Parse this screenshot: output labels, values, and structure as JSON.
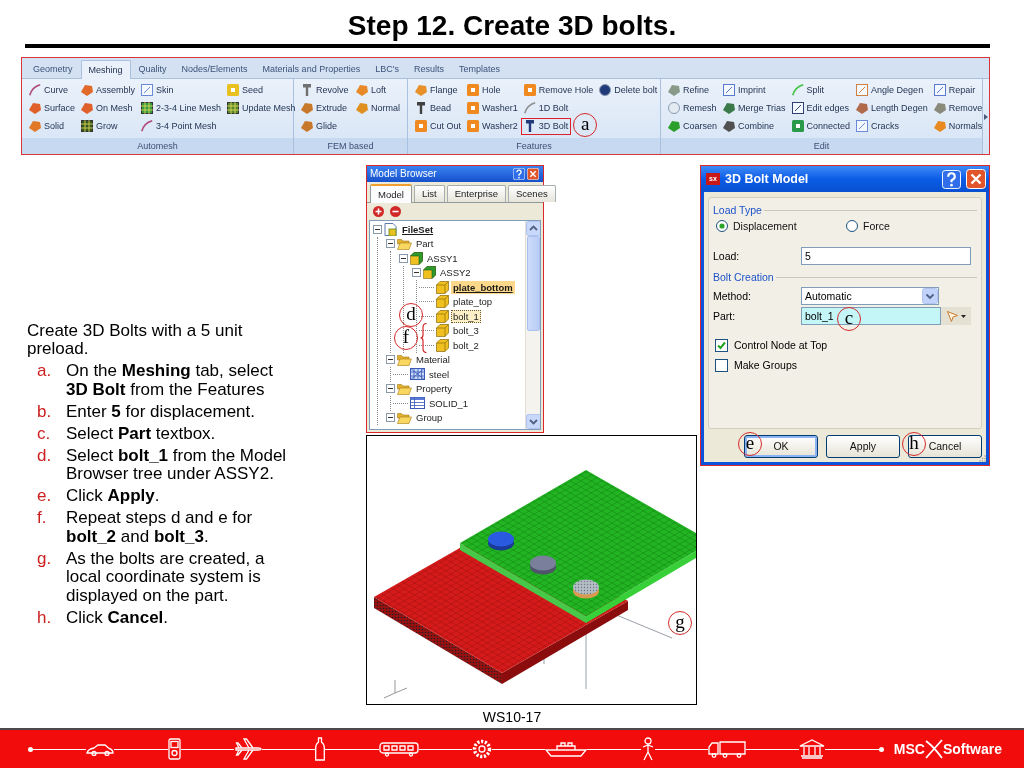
{
  "title": "Step 12. Create 3D bolts.",
  "ribbon": {
    "tabs": [
      {
        "label": "Geometry",
        "selected": false
      },
      {
        "label": "Meshing",
        "selected": true
      },
      {
        "label": "Quality",
        "selected": false
      },
      {
        "label": "Nodes/Elements",
        "selected": false
      },
      {
        "label": "Materials and Properties",
        "selected": false
      },
      {
        "label": "LBC's",
        "selected": false
      },
      {
        "label": "Results",
        "selected": false
      },
      {
        "label": "Templates",
        "selected": false
      }
    ],
    "groups": [
      {
        "label": "Automesh",
        "columns": [
          {
            "items": [
              {
                "label": "Curve"
              },
              {
                "label": "Surface"
              },
              {
                "label": "Solid"
              }
            ]
          },
          {
            "items": [
              {
                "label": "Assembly"
              },
              {
                "label": "On Mesh"
              },
              {
                "label": "Grow"
              }
            ]
          },
          {
            "items": [
              {
                "label": "Skin"
              },
              {
                "label": "2-3-4 Line Mesh"
              },
              {
                "label": "3-4 Point Mesh"
              }
            ]
          },
          {
            "items": [
              {
                "label": "Seed"
              },
              {
                "label": "Update Mesh"
              }
            ]
          }
        ]
      },
      {
        "label": "FEM based",
        "columns": [
          {
            "items": [
              {
                "label": "Revolve"
              },
              {
                "label": "Extrude"
              },
              {
                "label": "Glide"
              }
            ]
          },
          {
            "items": [
              {
                "label": "Loft"
              },
              {
                "label": "Normal"
              }
            ]
          }
        ]
      },
      {
        "label": "Features",
        "columns": [
          {
            "items": [
              {
                "label": "Flange"
              },
              {
                "label": "Bead"
              },
              {
                "label": "Cut Out"
              }
            ]
          },
          {
            "items": [
              {
                "label": "Hole"
              },
              {
                "label": "Washer1"
              },
              {
                "label": "Washer2"
              }
            ]
          },
          {
            "items": [
              {
                "label": "Remove Hole"
              },
              {
                "label": "1D Bolt"
              },
              {
                "label": "3D Bolt",
                "callout": {
                  "kind": "circle",
                  "label": "a"
                }
              }
            ]
          },
          {
            "items": [
              {
                "label": "Delete bolt"
              }
            ]
          }
        ]
      },
      {
        "label": "Edit",
        "columns": [
          {
            "items": [
              {
                "label": "Refine"
              },
              {
                "label": "Remesh"
              },
              {
                "label": "Coarsen"
              }
            ]
          },
          {
            "items": [
              {
                "label": "Imprint"
              },
              {
                "label": "Merge Trias"
              },
              {
                "label": "Combine"
              }
            ]
          },
          {
            "items": [
              {
                "label": "Split"
              },
              {
                "label": "Edit edges"
              },
              {
                "label": "Connected"
              }
            ]
          },
          {
            "items": [
              {
                "label": "Angle Degen"
              },
              {
                "label": "Length Degen"
              },
              {
                "label": "Cracks"
              }
            ]
          },
          {
            "items": [
              {
                "label": "Repair"
              },
              {
                "label": "Remove"
              },
              {
                "label": "Normals"
              }
            ]
          }
        ]
      }
    ]
  },
  "instructions": {
    "intro": "Create 3D Bolts with a 5 unit preload.",
    "steps": [
      {
        "marker": "a.",
        "text": "On the **Meshing** tab, select **3D Bolt** from the Features"
      },
      {
        "marker": "b.",
        "text": "Enter **5** for displacement."
      },
      {
        "marker": "c.",
        "text": "Select **Part** textbox."
      },
      {
        "marker": "d.",
        "text": "Select **bolt_1** from the Model Browser tree under ASSY2."
      },
      {
        "marker": "e.",
        "text": "Click **Apply**."
      },
      {
        "marker": "f.",
        "text": "Repeat steps d and e for **bolt_2** and **bolt_3**."
      },
      {
        "marker": "g.",
        "text": "As the bolts are created, a local coordinate system is displayed on the part."
      },
      {
        "marker": "h.",
        "text": "Click **Cancel**."
      }
    ]
  },
  "model_browser": {
    "title": "Model Browser",
    "tabs": [
      {
        "label": "Model",
        "selected": true
      },
      {
        "label": "List",
        "selected": false
      },
      {
        "label": "Enterprise",
        "selected": false
      },
      {
        "label": "Scenes",
        "selected": false
      }
    ],
    "tree": [
      {
        "label": "FileSet",
        "kind": "fileset",
        "expanded": true,
        "current": true,
        "selected": false,
        "children": [
          {
            "label": "Part",
            "kind": "folder",
            "expanded": true,
            "current": false,
            "selected": false,
            "children": [
              {
                "label": "ASSY1",
                "kind": "assembly",
                "expanded": true,
                "current": false,
                "selected": false,
                "children": [
                  {
                    "label": "ASSY2",
                    "kind": "assembly",
                    "expanded": true,
                    "current": false,
                    "selected": false,
                    "children": [
                      {
                        "label": "plate_bottom",
                        "kind": "part",
                        "current": true,
                        "selected": false
                      },
                      {
                        "label": "plate_top",
                        "kind": "part",
                        "current": false,
                        "selected": false
                      },
                      {
                        "label": "bolt_1",
                        "kind": "part",
                        "current": false,
                        "selected": true,
                        "callout": {
                          "kind": "circle",
                          "label": "d"
                        }
                      },
                      {
                        "label": "bolt_3",
                        "kind": "part",
                        "current": false,
                        "selected": false,
                        "callout": {
                          "kind": "brace",
                          "label": "f"
                        }
                      },
                      {
                        "label": "bolt_2",
                        "kind": "part",
                        "current": false,
                        "selected": false
                      }
                    ]
                  }
                ]
              }
            ]
          },
          {
            "label": "Material",
            "kind": "folder",
            "expanded": true,
            "current": false,
            "selected": false,
            "children": [
              {
                "label": "steel",
                "kind": "material",
                "current": false,
                "selected": false
              }
            ]
          },
          {
            "label": "Property",
            "kind": "folder",
            "expanded": true,
            "current": false,
            "selected": false,
            "children": [
              {
                "label": "SOLID_1",
                "kind": "property",
                "current": false,
                "selected": false
              }
            ]
          },
          {
            "label": "Group",
            "kind": "folder",
            "expanded": true,
            "current": false,
            "selected": false
          }
        ]
      }
    ]
  },
  "viewport": {
    "callout": {
      "kind": "circle",
      "label": "g"
    }
  },
  "caption": "WS10-17",
  "dialog": {
    "title": "3D Bolt Model",
    "icon_label": "sx",
    "load_type": {
      "label": "Load Type",
      "options": [
        {
          "label": "Displacement",
          "selected": true
        },
        {
          "label": "Force",
          "selected": false
        }
      ]
    },
    "load": {
      "label": "Load:",
      "value": "5"
    },
    "bolt_creation": {
      "label": "Bolt Creation",
      "method": {
        "label": "Method:",
        "value": "Automatic"
      },
      "part": {
        "label": "Part:",
        "value": "bolt_1",
        "active": true,
        "callout": {
          "kind": "circle",
          "label": "c"
        }
      }
    },
    "options": [
      {
        "label": "Control Node at Top",
        "checked": true
      },
      {
        "label": "Make Groups",
        "checked": false
      }
    ],
    "buttons": [
      {
        "label": "OK",
        "focused": true,
        "callout": {
          "kind": "circle",
          "label": "e"
        }
      },
      {
        "label": "Apply",
        "focused": false
      },
      {
        "label": "Cancel",
        "focused": false,
        "callout": {
          "kind": "circle",
          "label": "h"
        }
      }
    ]
  },
  "footer": {
    "logo": [
      "MSC",
      "Software"
    ]
  }
}
